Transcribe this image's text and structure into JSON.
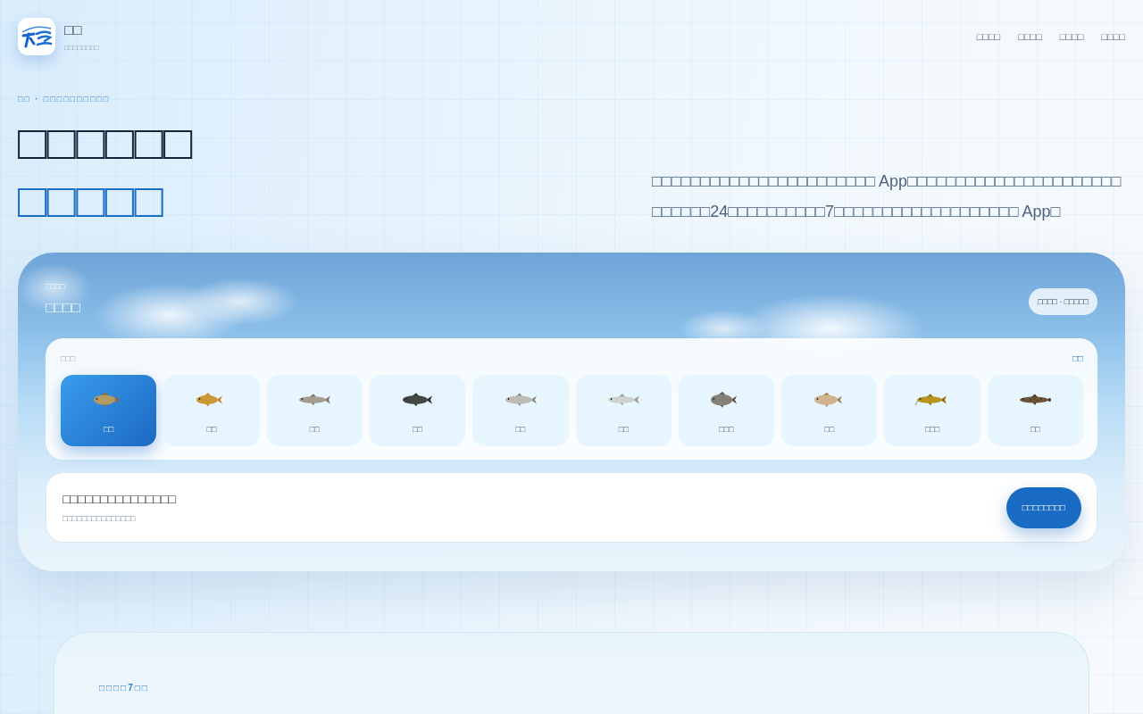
{
  "header": {
    "brand_name": "□□",
    "brand_tagline": "□□□□□□□□",
    "nav": [
      "□□□□",
      "□□□□",
      "□□□□",
      "□□□□"
    ]
  },
  "hero": {
    "breadcrumb": "□□ · □□□□□□□□□□",
    "title": "□□□□□□",
    "title_accent": "□□□□□",
    "description": "□□□□□□□□□□□□□□□□□□□□□□□ App□□□□□□□□□□□□□□□□□□□□□□□□□□□□24□□□□□□□□□□7□□□□□□□□□□□□□□□□□□□ App□"
  },
  "tool_card": {
    "eyebrow": "□□□□",
    "title": "□□□□",
    "badge": "□□□□ · □□□□□",
    "picker": {
      "label": "□□□",
      "link": "□□",
      "fish": [
        {
          "name": "□□",
          "selected": true
        },
        {
          "name": "□□",
          "selected": false
        },
        {
          "name": "□□",
          "selected": false
        },
        {
          "name": "□□",
          "selected": false
        },
        {
          "name": "□□",
          "selected": false
        },
        {
          "name": "□□",
          "selected": false
        },
        {
          "name": "□□□",
          "selected": false
        },
        {
          "name": "□□",
          "selected": false
        },
        {
          "name": "□□□",
          "selected": false
        },
        {
          "name": "□□",
          "selected": false
        }
      ]
    },
    "prompt": {
      "title": "□□□□□□□□□□□□□□□",
      "subtitle": "□□□□□□□□□□□□□□□",
      "button": "□□□□□□□□"
    }
  },
  "next_section": {
    "eyebrow": "□□□□7□□"
  }
}
